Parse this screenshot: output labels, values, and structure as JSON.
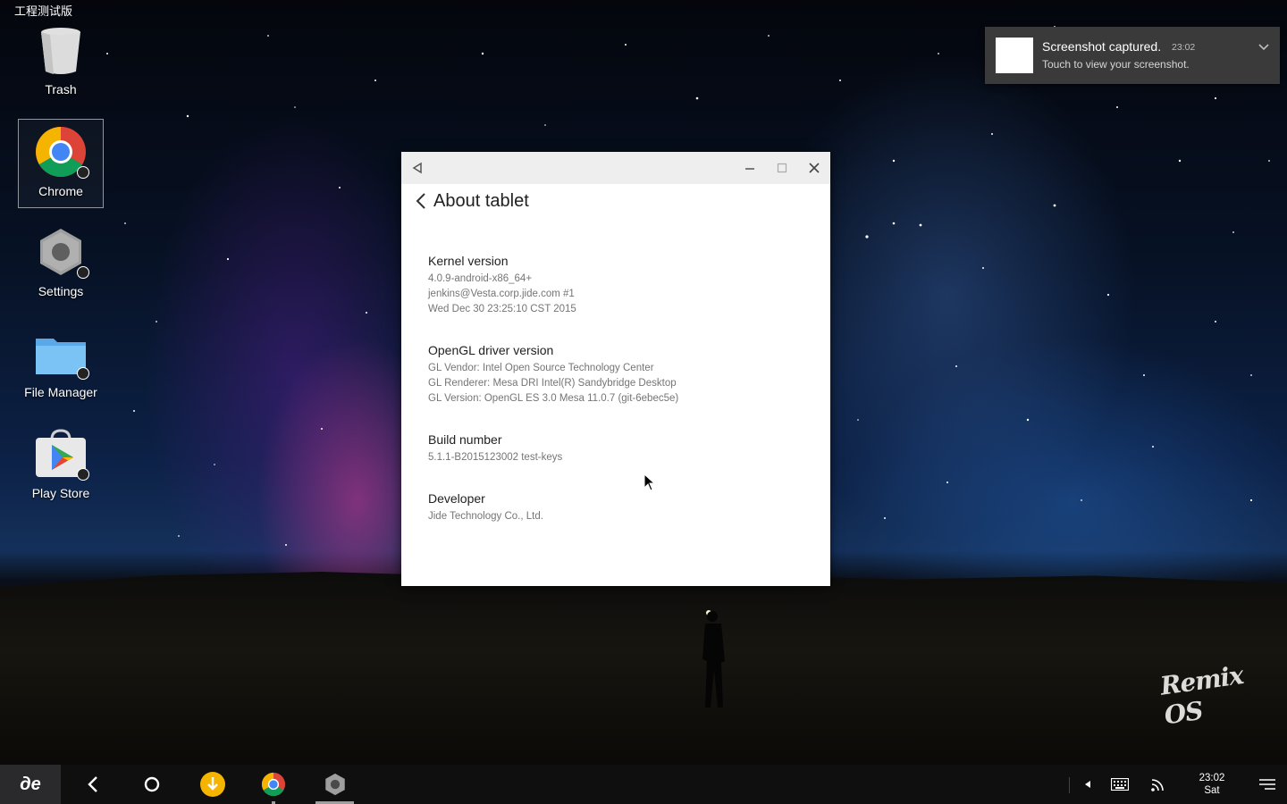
{
  "desktop": {
    "build_tag": "工程测试版",
    "watermark": "Remix OS",
    "icons": [
      {
        "label": "Trash",
        "icon": "trash-icon"
      },
      {
        "label": "Chrome",
        "icon": "chrome-icon"
      },
      {
        "label": "Settings",
        "icon": "settings-icon"
      },
      {
        "label": "File Manager",
        "icon": "folder-icon"
      },
      {
        "label": "Play Store",
        "icon": "play-store-icon"
      }
    ]
  },
  "window": {
    "header_title": "About tablet",
    "items": [
      {
        "title": "Kernel version",
        "summary": [
          "4.0.9-android-x86_64+",
          "jenkins@Vesta.corp.jide.com #1",
          "Wed Dec 30 23:25:10 CST 2015"
        ]
      },
      {
        "title": "OpenGL driver version",
        "summary": [
          "GL Vendor: Intel Open Source Technology Center",
          "GL Renderer: Mesa DRI Intel(R) Sandybridge Desktop",
          "GL Version: OpenGL ES 3.0 Mesa 11.0.7 (git-6ebec5e)"
        ]
      },
      {
        "title": "Build number",
        "summary": [
          "5.1.1-B2015123002 test-keys"
        ]
      },
      {
        "title": "Developer",
        "summary": [
          "Jide Technology Co., Ltd."
        ]
      }
    ]
  },
  "notification": {
    "title": "Screenshot captured.",
    "time": "23:02",
    "body": "Touch to view your screenshot."
  },
  "taskbar": {
    "start_label": "де",
    "clock_time": "23:02",
    "clock_day": "Sat",
    "colors": {
      "download": "#f4b400",
      "settings_active": "#9e9e9e"
    }
  }
}
